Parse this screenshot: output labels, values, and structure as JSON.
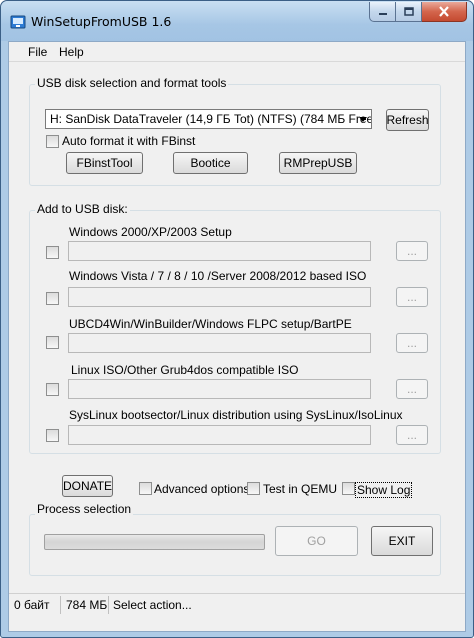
{
  "window": {
    "title": "WinSetupFromUSB 1.6"
  },
  "menu": {
    "file": "File",
    "help": "Help"
  },
  "usb_tools": {
    "group_title": "USB disk selection and format tools",
    "disk_selected": "H: SanDisk DataTraveler (14,9 ГБ Tot) (NTFS) (784 МБ Free)",
    "refresh_label": "Refresh",
    "auto_format_label": "Auto format it with FBinst",
    "auto_format_checked": false,
    "fbinsttool_label": "FBinstTool",
    "bootice_label": "Bootice",
    "rmprepusb_label": "RMPrepUSB"
  },
  "add_to_usb": {
    "group_title": "Add to USB disk:",
    "browse_label": "...",
    "items": [
      {
        "label": "Windows 2000/XP/2003 Setup",
        "value": "",
        "checked": false
      },
      {
        "label": "Windows Vista / 7 / 8 / 10 /Server 2008/2012 based ISO",
        "value": "",
        "checked": false
      },
      {
        "label": "UBCD4Win/WinBuilder/Windows FLPC setup/BartPE",
        "value": "",
        "checked": false
      },
      {
        "label": "Linux ISO/Other Grub4dos compatible ISO",
        "value": "",
        "checked": false
      },
      {
        "label": "SysLinux bootsector/Linux distribution using SysLinux/IsoLinux",
        "value": "",
        "checked": false
      }
    ]
  },
  "options": {
    "donate_label": "DONATE",
    "advanced_label": "Advanced options",
    "qemu_label": "Test in QEMU",
    "show_log_label": "Show Log"
  },
  "process": {
    "group_title": "Process selection",
    "progress": 0,
    "go_label": "GO",
    "exit_label": "EXIT"
  },
  "status": {
    "size": "0 байт",
    "free": "784 МБ",
    "message": "Select action..."
  }
}
